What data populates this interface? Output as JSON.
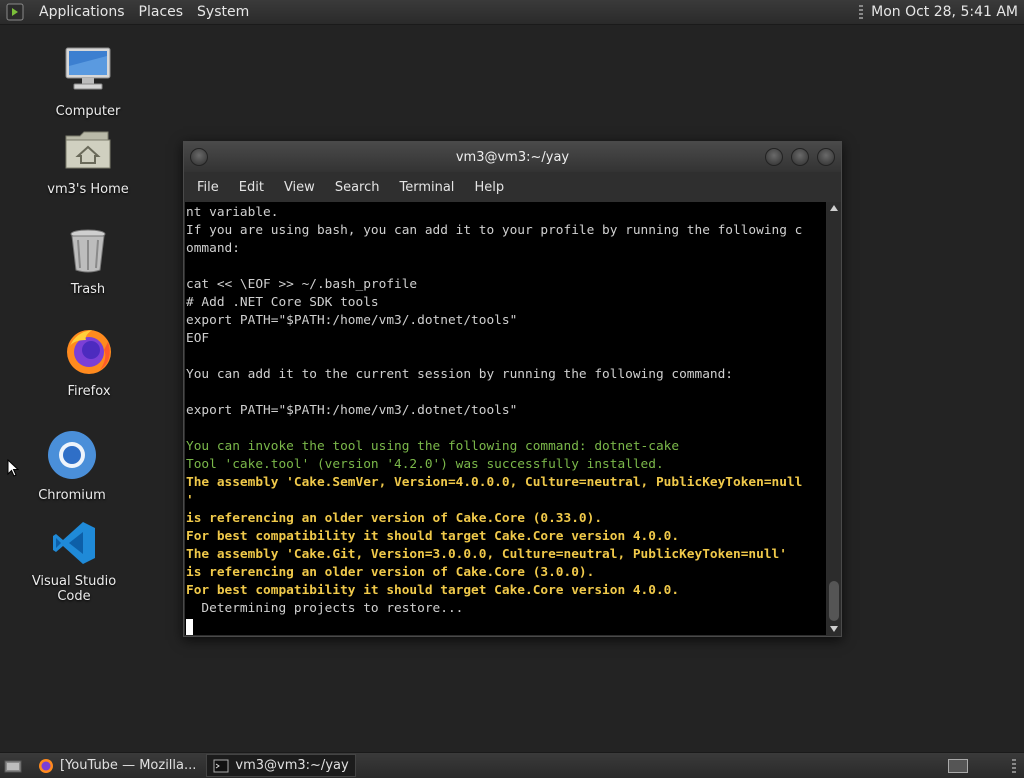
{
  "top_panel": {
    "menus": [
      "Applications",
      "Places",
      "System"
    ],
    "datetime": "Mon Oct 28,  5:41 AM"
  },
  "desktop": {
    "icons": [
      {
        "label": "Computer",
        "icon": "computer-icon"
      },
      {
        "label": "vm3's Home",
        "icon": "home-folder-icon"
      },
      {
        "label": "Trash",
        "icon": "trash-icon"
      },
      {
        "label": "Firefox",
        "icon": "firefox-icon"
      },
      {
        "label": "Chromium",
        "icon": "chromium-icon"
      },
      {
        "label": "Visual Studio Code",
        "icon": "vscode-icon"
      }
    ]
  },
  "terminal": {
    "title": "vm3@vm3:~/yay",
    "menu": [
      "File",
      "Edit",
      "View",
      "Search",
      "Terminal",
      "Help"
    ],
    "lines": [
      {
        "text": "nt variable.",
        "style": "normal"
      },
      {
        "text": "If you are using bash, you can add it to your profile by running the following c",
        "style": "normal"
      },
      {
        "text": "ommand:",
        "style": "normal"
      },
      {
        "text": "",
        "style": "normal"
      },
      {
        "text": "cat << \\EOF >> ~/.bash_profile",
        "style": "normal"
      },
      {
        "text": "# Add .NET Core SDK tools",
        "style": "normal"
      },
      {
        "text": "export PATH=\"$PATH:/home/vm3/.dotnet/tools\"",
        "style": "normal"
      },
      {
        "text": "EOF",
        "style": "normal"
      },
      {
        "text": "",
        "style": "normal"
      },
      {
        "text": "You can add it to the current session by running the following command:",
        "style": "normal"
      },
      {
        "text": "",
        "style": "normal"
      },
      {
        "text": "export PATH=\"$PATH:/home/vm3/.dotnet/tools\"",
        "style": "normal"
      },
      {
        "text": "",
        "style": "normal"
      },
      {
        "text": "You can invoke the tool using the following command: dotnet-cake",
        "style": "green"
      },
      {
        "text": "Tool 'cake.tool' (version '4.2.0') was successfully installed.",
        "style": "green"
      },
      {
        "text": "The assembly 'Cake.SemVer, Version=4.0.0.0, Culture=neutral, PublicKeyToken=null",
        "style": "yellow"
      },
      {
        "text": "'",
        "style": "yellow"
      },
      {
        "text": "is referencing an older version of Cake.Core (0.33.0).",
        "style": "yellow"
      },
      {
        "text": "For best compatibility it should target Cake.Core version 4.0.0.",
        "style": "yellow"
      },
      {
        "text": "The assembly 'Cake.Git, Version=3.0.0.0, Culture=neutral, PublicKeyToken=null'",
        "style": "yellow"
      },
      {
        "text": "is referencing an older version of Cake.Core (3.0.0).",
        "style": "yellow"
      },
      {
        "text": "For best compatibility it should target Cake.Core version 4.0.0.",
        "style": "yellow"
      },
      {
        "text": "  Determining projects to restore...",
        "style": "normal"
      }
    ]
  },
  "taskbar": {
    "tasks": [
      {
        "label": "[YouTube — Mozilla...",
        "icon": "firefox-icon",
        "active": false
      },
      {
        "label": "vm3@vm3:~/yay",
        "icon": "terminal-icon",
        "active": true
      }
    ]
  }
}
